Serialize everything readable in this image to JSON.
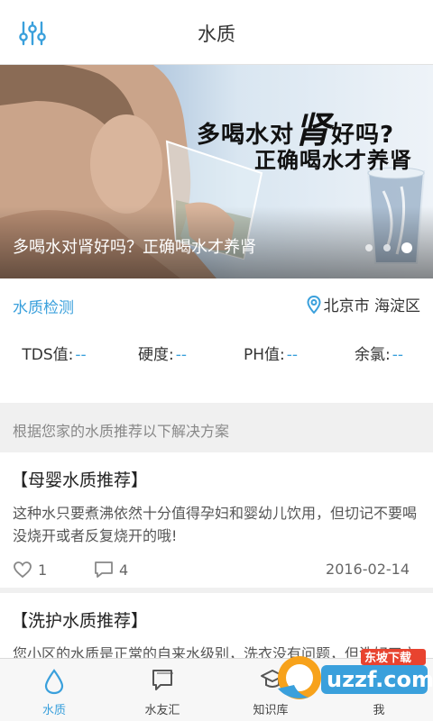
{
  "header": {
    "title": "水质",
    "menu_icon": "equalizer-icon"
  },
  "banner": {
    "headline_part1": "多喝水对",
    "headline_big": "肾",
    "headline_part2": "好吗?",
    "headline_line2": "正确喝水才养肾",
    "caption": "多喝水对肾好吗？正确喝水才养肾",
    "slide_count": 3,
    "active_slide": 3
  },
  "quality": {
    "link_label": "水质检测",
    "location": "北京市 海淀区",
    "metrics": [
      {
        "label": "TDS值:",
        "value": "--"
      },
      {
        "label": "硬度:",
        "value": "--"
      },
      {
        "label": "PH值:",
        "value": "--"
      },
      {
        "label": "余氯:",
        "value": "--"
      }
    ]
  },
  "section_hint": "根据您家的水质推荐以下解决方案",
  "cards": [
    {
      "title": "【母婴水质推荐】",
      "body": "这种水只要煮沸依然十分值得孕妇和婴幼儿饮用，但切记不要喝没烧开或者反复烧开的哦!",
      "likes": "1",
      "comments": "4",
      "date": "2016-02-14"
    },
    {
      "title": "【洗护水质推荐】",
      "body": "您小区的水质是正常的自来水级别，洗衣没有问题，但洗好了衣服后要注意..."
    }
  ],
  "tabs": [
    {
      "label": "水质",
      "icon": "water-drop-icon",
      "active": true
    },
    {
      "label": "水友汇",
      "icon": "chat-icon",
      "active": false
    },
    {
      "label": "知识库",
      "icon": "graduation-cap-icon",
      "active": false
    },
    {
      "label": "我",
      "icon": "user-icon",
      "active": false
    }
  ],
  "watermark": {
    "text": "uzzf.com",
    "tagline": "东坡下载"
  },
  "colors": {
    "accent": "#3aa0dc",
    "background": "#f0f0f0"
  }
}
